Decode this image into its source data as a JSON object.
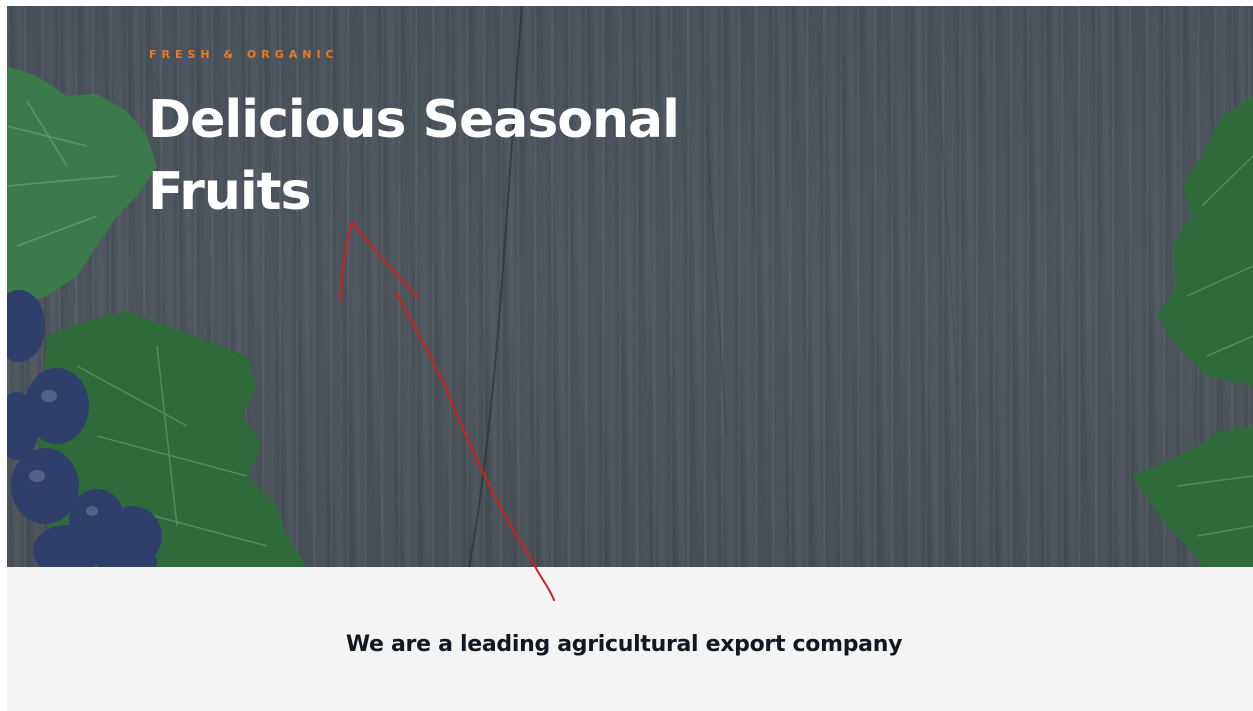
{
  "hero": {
    "eyebrow": "FRESH & ORGANIC",
    "headline_line1": "Delicious Seasonal",
    "headline_line2": "Fruits",
    "background_image": "wood-plank-texture",
    "decorations": [
      "grape-leaves",
      "dark-grapes"
    ]
  },
  "about": {
    "title": "We are a leading agricultural export company"
  },
  "annotation": {
    "type": "hand-drawn-arrow",
    "color": "#d11f1f"
  },
  "colors": {
    "accent": "#e87a22",
    "headline": "#ffffff",
    "hero_overlay": "#4a5259",
    "section_bg": "#f4f4f4",
    "section_text": "#101820",
    "leaf_green": "#2f6b3a",
    "grape_blue": "#2e3f6b"
  }
}
